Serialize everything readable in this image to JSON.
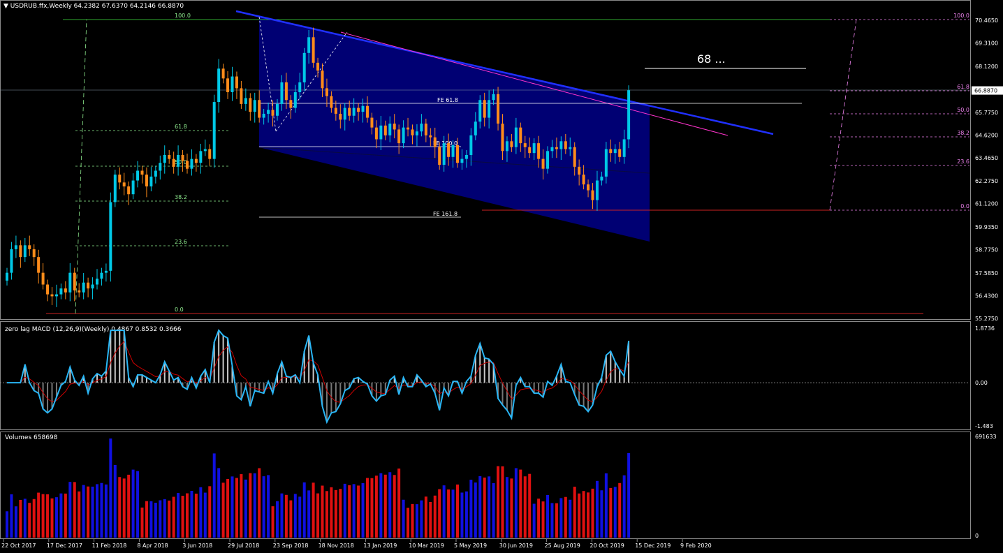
{
  "main": {
    "symbol_title": "USDRUB.ffx,Weekly",
    "ohlc": "64.2382 67.6370 64.2146 66.8870",
    "current_price_label": "66.8870",
    "price_ticks": [
      "70.4650",
      "69.3100",
      "68.1200",
      "66.9650",
      "65.7750",
      "64.6200",
      "63.4650",
      "62.2750",
      "61.1200",
      "59.9350",
      "58.7750",
      "57.5850",
      "56.4300",
      "55.2750"
    ],
    "annotation_big": "68 ...",
    "fib_left_levels": [
      "100.0",
      "61.8",
      "50.0",
      "38.2",
      "23.6",
      "0.0"
    ],
    "fib_right_levels": [
      "100.0",
      "61.8",
      "50.0",
      "38.2",
      "23.6",
      "0.0"
    ],
    "fe_labels": [
      "FE 61.8",
      "FE 100.0",
      "FE 161.8"
    ]
  },
  "macd": {
    "title": "zero lag MACD (12,26,9)(Weekly) 0.4867 0.8532 0.3666",
    "ticks": [
      "1.8736",
      "0.00",
      "-1.483"
    ]
  },
  "volume": {
    "title": "Volumes 658698",
    "ticks": [
      "691633",
      "0"
    ]
  },
  "x_labels": [
    "22 Oct 2017",
    "17 Dec 2017",
    "11 Feb 2018",
    "8 Apr 2018",
    "3 Jun 2018",
    "29 Jul 2018",
    "23 Sep 2018",
    "18 Nov 2018",
    "13 Jan 2019",
    "10 Mar 2019",
    "5 May 2019",
    "30 Jun 2019",
    "25 Aug 2019",
    "20 Oct 2019",
    "15 Dec 2019",
    "9 Feb 2020"
  ],
  "colors": {
    "bull": "#00c8e6",
    "bear": "#ff8c1a",
    "channel": "#000080",
    "vol_up": "#1010e0",
    "vol_down": "#e01010",
    "macd_line": "#29b6f6",
    "signal_line": "#cc0000",
    "fib_left": "#90ee90",
    "fib_right": "#ee82ee"
  },
  "chart_data": {
    "type": "candlestick",
    "title": "USDRUB.ffx,Weekly",
    "ylim": [
      55.275,
      70.465
    ],
    "closes": [
      57.6,
      58.8,
      59.0,
      58.4,
      59.0,
      58.8,
      58.4,
      57.6,
      57.0,
      56.5,
      56.4,
      56.5,
      56.8,
      56.6,
      57.6,
      56.7,
      56.6,
      57.1,
      56.8,
      57.0,
      57.3,
      57.6,
      57.7,
      61.2,
      62.6,
      62.2,
      62.0,
      61.6,
      62.3,
      62.8,
      62.6,
      62.0,
      62.5,
      62.8,
      63.2,
      63.6,
      63.4,
      63.0,
      63.6,
      63.3,
      62.9,
      63.4,
      63.2,
      63.8,
      63.9,
      63.4,
      66.3,
      68.0,
      67.5,
      66.8,
      67.6,
      67.0,
      66.2,
      66.5,
      65.8,
      66.4,
      65.5,
      65.7,
      65.9,
      65.6,
      66.2,
      67.3,
      66.4,
      66.0,
      66.8,
      67.3,
      68.8,
      69.6,
      68.3,
      67.9,
      67.0,
      66.6,
      66.0,
      65.7,
      65.4,
      66.0,
      65.6,
      66.0,
      65.8,
      66.1,
      65.5,
      65.0,
      64.4,
      65.1,
      64.6,
      65.2,
      64.9,
      64.2,
      65.0,
      64.9,
      64.6,
      64.8,
      65.2,
      64.6,
      64.5,
      64.0,
      63.1,
      64.2,
      63.5,
      64.1,
      63.2,
      63.4,
      63.6,
      64.6,
      65.3,
      66.4,
      65.5,
      66.4,
      66.7,
      65.2,
      63.8,
      64.3,
      64.0,
      65.0,
      64.2,
      64.0,
      63.7,
      64.2,
      63.4,
      62.9,
      63.8,
      64.0,
      63.9,
      64.3,
      63.9,
      64.0,
      63.0,
      62.6,
      62.1,
      61.8,
      61.3,
      62.3,
      62.5,
      63.9,
      63.7,
      63.9,
      63.5,
      64.4,
      66.9
    ],
    "macd_ylim": [
      -1.483,
      1.8736
    ],
    "volume_ylim": [
      0,
      691633
    ]
  }
}
